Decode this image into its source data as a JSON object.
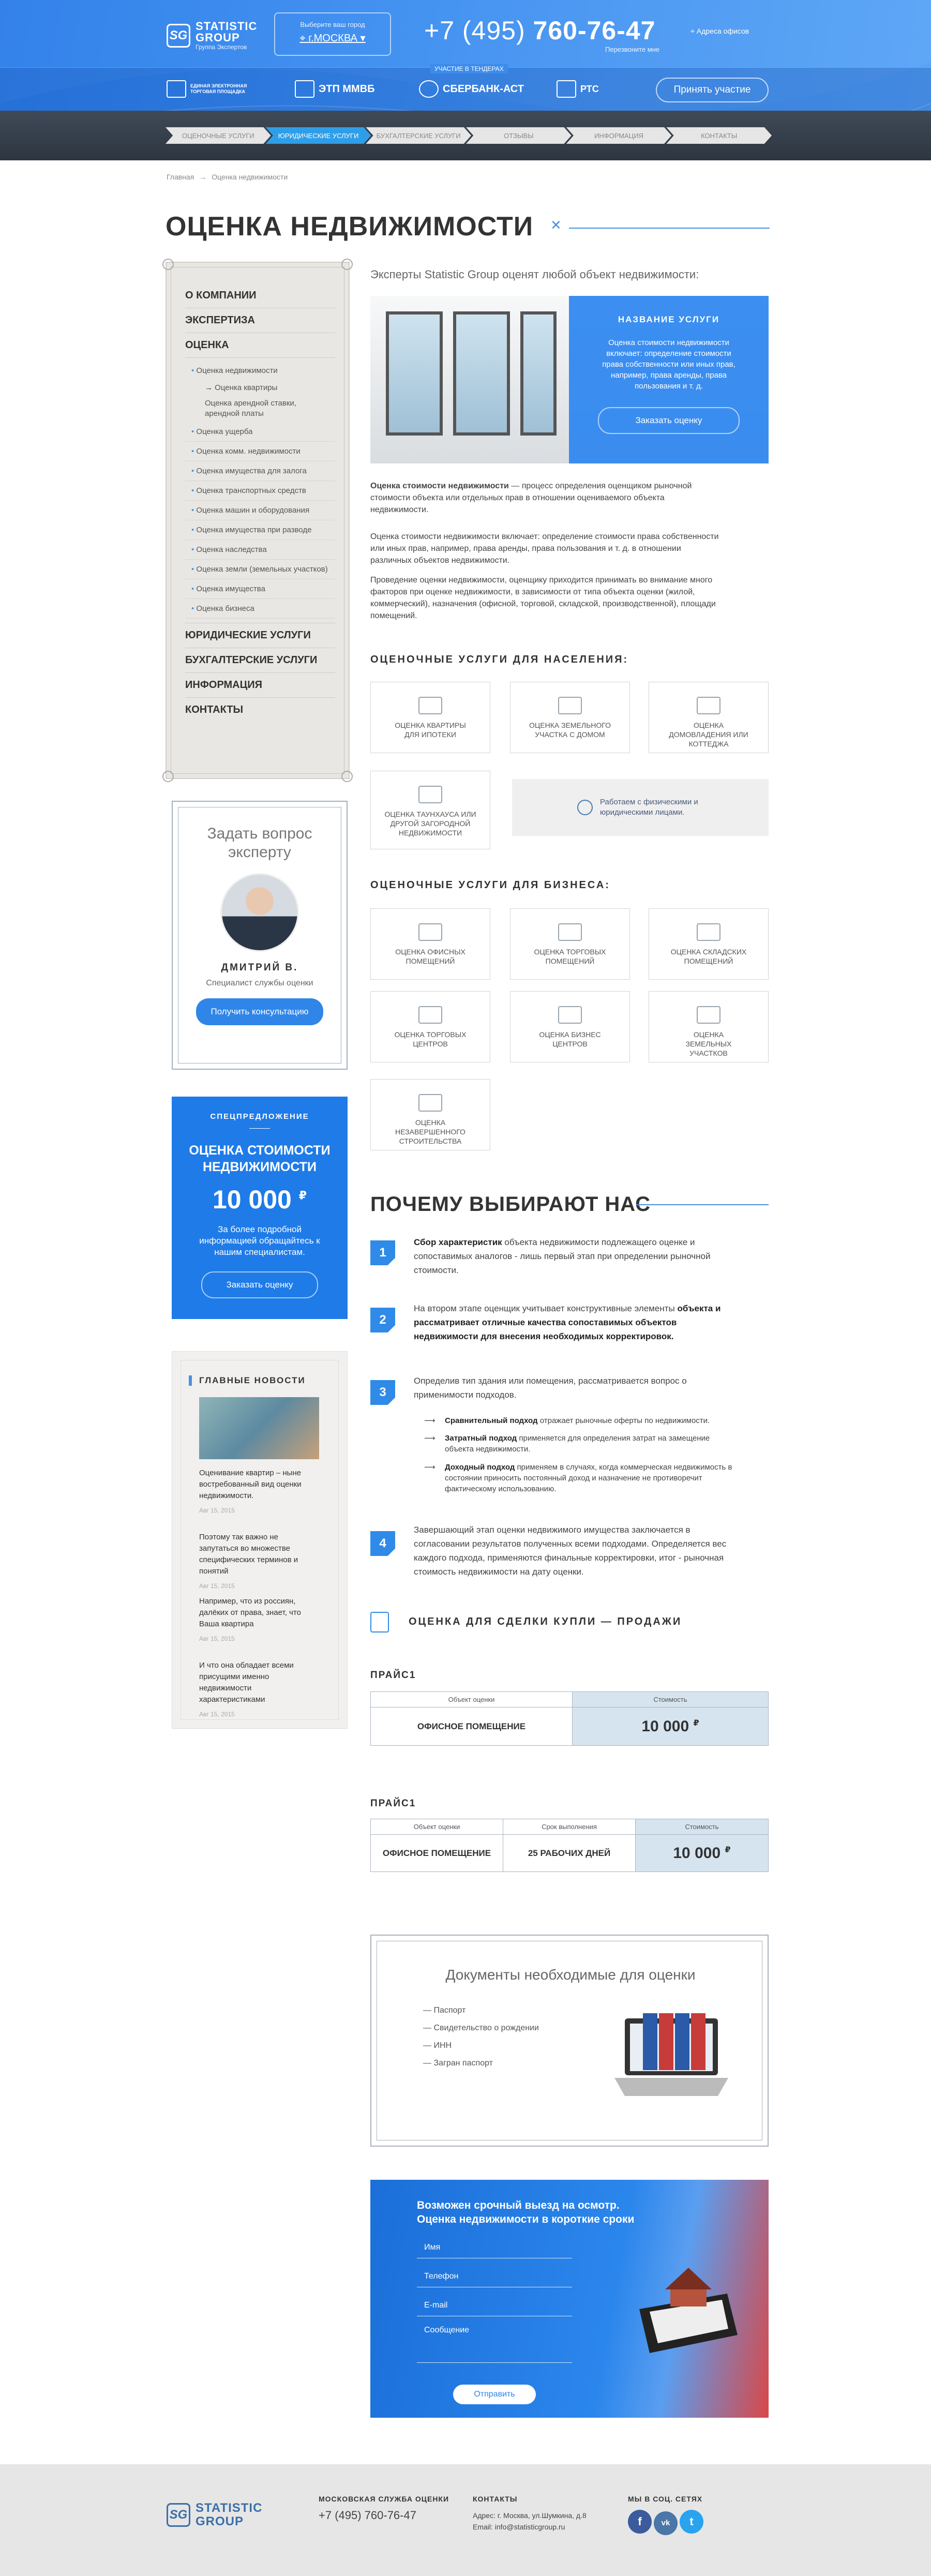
{
  "header": {
    "logo_name": "STATISTIC GROUP",
    "logo_sub": "Группа Экспертов",
    "logo_mark": "SG",
    "city_label": "Выберите ваш город",
    "city_value": "г.МОСКВА",
    "phone_code": "+7 (495)",
    "phone_num": "760-76-47",
    "phone_sub": "Перезвоните мне",
    "address": "Адреса офисов",
    "partners_label": "УЧАСТИЕ В ТЕНДЕРАХ",
    "partners": [
      "ЕДИНАЯ ЭЛЕКТРОННАЯ ТОРГОВАЯ ПЛОЩАДКА",
      "ЭТП ММВБ",
      "СБЕРБАНК-АСТ",
      "РТС"
    ],
    "partner_button": "Принять участие"
  },
  "steps": [
    "ОЦЕНОЧНЫЕ УСЛУГИ",
    "ЮРИДИЧЕСКИЕ УСЛУГИ",
    "БУХГАЛТЕРСКИЕ УСЛУГИ",
    "ОТЗЫВЫ",
    "ИНФОРМАЦИЯ",
    "КОНТАКТЫ"
  ],
  "breadcrumb": {
    "home": "Главная",
    "sep": "→",
    "current": "Оценка недвижимости"
  },
  "page_title": "ОЦЕНКА НЕДВИЖИМОСТИ",
  "sidebar": {
    "top": [
      "О КОМПАНИИ",
      "ЭКСПЕРТИЗА",
      "ОЦЕНКА"
    ],
    "sub_open": "Оценка недвижимости",
    "sub3": [
      "Оценка квартиры",
      "Оценка арендной ставки, арендной платы"
    ],
    "sub": [
      "Оценка ущерба",
      "Оценка комм. недвижимости",
      "Оценка имущества для залога",
      "Оценка транспортных средств",
      "Оценка машин и оборудования",
      "Оценка имущества при разводе",
      "Оценка наследства",
      "Оценка земли (земельных участков)",
      "Оценка имущества",
      "Оценка бизнеса"
    ],
    "bottom": [
      "ЮРИДИЧЕСКИЕ УСЛУГИ",
      "БУХГАЛТЕРСКИЕ УСЛУГИ",
      "ИНФОРМАЦИЯ",
      "КОНТАКТЫ"
    ]
  },
  "expert": {
    "title": "Задать вопрос эксперту",
    "name": "ДМИТРИЙ В.",
    "position": "Специалист службы оценки",
    "button": "Получить консультацию"
  },
  "offer": {
    "kicker": "СПЕЦПРЕДЛОЖЕНИЕ",
    "title": "ОЦЕНКА СТОИМОСТИ НЕДВИЖИМОСТИ",
    "price": "10 000",
    "currency": "₽",
    "desc": "За более подробной информацией обращайтесь к нашим специалистам.",
    "button": "Заказать оценку"
  },
  "news": {
    "title": "ГЛАВНЫЕ НОВОСТИ",
    "items": [
      {
        "text": "Оценивание квартир – ныне востребованный вид оценки недвижимости.",
        "date": "Авг 15, 2015"
      },
      {
        "text": "Поэтому так важно не запутаться во множестве специфических терминов и понятий",
        "date": "Авг 15, 2015"
      },
      {
        "text": " Например, что из россиян, далёких от права, знает, что Ваша квартира",
        "date": "Авг 15, 2015"
      },
      {
        "text": "И что она обладает всеми присущими именно недвижимости характеристиками",
        "date": "Авг 15, 2015"
      }
    ]
  },
  "lead": "Эксперты Statistic Group оценят любой объект недвижимости:",
  "hero": {
    "title": "НАЗВАНИЕ УСЛУГИ",
    "text": "Оценка стоимости недвижимости включает: определение стоимости права собственности или иных прав, например, права аренды, права пользования и т. д.",
    "button": "Заказать оценку"
  },
  "intro": {
    "p1_bold": "Оценка стоимости недвижимости",
    "p1": " — процесс определения оценщиком рыночной стоимости объекта или отдельных прав в отношении оцениваемого объекта недвижимости.",
    "p2": "Оценка стоимости недвижимости включает: определение стоимости права собственности или иных прав, например, права аренды, права пользования и т. д. в отношении различных объектов недвижимости.",
    "p3": "Проведение оценки недвижимости, оценщику приходится принимать во внимание много факторов при оценке недвижимости, в зависимости от типа объекта оценки (жилой, коммерческий), назначения (офисной, торговой, складской, производственной), площади помещений."
  },
  "population": {
    "title": "ОЦЕНОЧНЫЕ УСЛУГИ ДЛЯ НАСЕЛЕНИЯ:",
    "cards": [
      "ОЦЕНКА КВАРТИРЫ ДЛЯ ИПОТЕКИ",
      "ОЦЕНКА ЗЕМЕЛЬНОГО УЧАСТКА С ДОМОМ",
      "ОЦЕНКА ДОМОВЛАДЕНИЯ ИЛИ КОТТЕДЖА",
      "ОЦЕНКА ТАУНХАУСА ИЛИ ДРУГОЙ ЗАГОРОДНОЙ НЕДВИЖИМОСТИ"
    ],
    "note": "Работаем с физическими и юридическими лицами."
  },
  "business": {
    "title": "ОЦЕНОЧНЫЕ УСЛУГИ ДЛЯ БИЗНЕСА:",
    "cards": [
      "ОЦЕНКА ОФИСНЫХ ПОМЕЩЕНИЙ",
      "ОЦЕНКА ТОРГОВЫХ ПОМЕЩЕНИЙ",
      "ОЦЕНКА СКЛАДСКИХ ПОМЕЩЕНИЙ",
      "ОЦЕНКА ТОРГОВЫХ ЦЕНТРОВ",
      "ОЦЕНКА БИЗНЕС ЦЕНТРОВ",
      "ОЦЕНКА ЗЕМЕЛЬНЫХ УЧАСТКОВ",
      "ОЦЕНКА НЕЗАВЕРШЕННОГО СТРОИТЕЛЬСТВА"
    ]
  },
  "why": {
    "title": "ПОЧЕМУ ВЫБИРАЮТ НАС",
    "s1_bold": "Сбор характеристик",
    "s1": " объекта недвижимости подлежащего оценке и сопоставимых аналогов - лишь первый этап при определении рыночной стоимости.",
    "s2_a": "На втором этапе оценщик учитывает конструктивные элементы ",
    "s2_bold": "объекта и рассматривает отличные качества сопоставимых объектов недвижимости для внесения необходимых корректировок.",
    "s3": "Определив тип здания или помещения, рассматривается вопрос о применимости подходов.",
    "s3_items": [
      {
        "b": "Сравнительный подход",
        "t": " отражает рыночные оферты по недвижимости."
      },
      {
        "b": "Затратный подход",
        "t": " применяется для определения затрат на замещение объекта недвижимости."
      },
      {
        "b": "Доходный подход",
        "t": " применяем в случаях, когда коммерческая недвижимость в состоянии приносить постоянный доход и назначение не противоречит фактическому использованию."
      }
    ],
    "s4": "Завершающий этап оценки недвижимого имущества заключается в согласовании результатов полученных всеми подходами. Определяется вес каждого подхода, применяются финальные корректировки, итог - рыночная стоимость недвижимости на дату оценки."
  },
  "deal": {
    "title": "ОЦЕНКА ДЛЯ СДЕЛКИ КУПЛИ — ПРОДАЖИ"
  },
  "price1": {
    "label": "ПРАЙС1",
    "h1": "Объект оценки",
    "h2": "Стоимость",
    "obj": "ОФИСНОЕ ПОМЕЩЕНИЕ",
    "price": "10 000",
    "cur": "₽"
  },
  "price2": {
    "label": "ПРАЙС1",
    "h1": "Объект оценки",
    "h2": "Срок выполнения",
    "h3": "Стоимость",
    "obj": "ОФИСНОЕ ПОМЕЩЕНИЕ",
    "term": "25 РАБОЧИХ ДНЕЙ",
    "price": "10 000",
    "cur": "₽"
  },
  "docs": {
    "title": "Документы необходимые для оценки",
    "items": [
      "— Паспорт",
      "— Свидетельство о рождении",
      "— ИНН",
      "— Загран паспорт"
    ]
  },
  "form": {
    "title1": "Возможен срочный выезд на осмотр.",
    "title2": "Оценка недвижимости в короткие сроки",
    "name": "Имя",
    "phone": "Телефон",
    "email": "E-mail",
    "message": "Сообщение",
    "button": "Отправить"
  },
  "footer": {
    "logo": "STATISTIC GROUP",
    "logo_mark": "SG",
    "c1_title": "МОСКОВСКАЯ СЛУЖБА ОЦЕНКИ",
    "c1_phone": "+7 (495) 760-76-47",
    "c2_title": "КОНТАКТЫ",
    "c2_addr": "Адрес: г. Москва, ул.Шумкина, д.8",
    "c2_mail": "Email: info@statisticgroup.ru",
    "c3_title": "МЫ В СОЦ. СЕТЯХ",
    "social": [
      "f",
      "vk",
      "t"
    ]
  }
}
